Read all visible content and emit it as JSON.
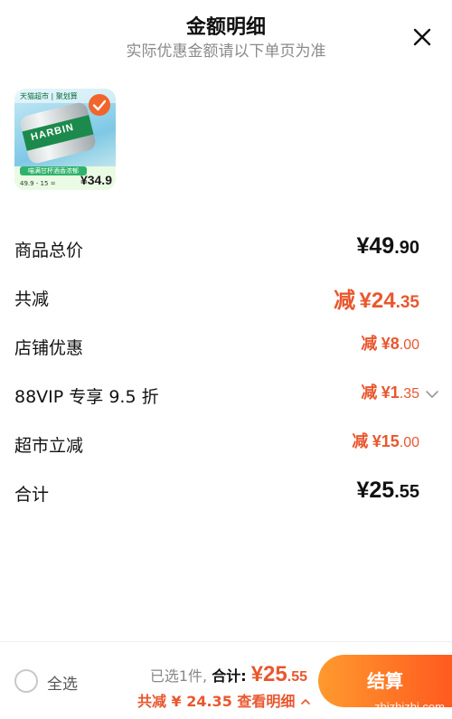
{
  "header": {
    "title": "金额明细",
    "subtitle": "实际优惠金额请以下单页为准"
  },
  "product": {
    "tag_text": "天猫超市 | 聚划算",
    "brand_text": "HARBIN",
    "green_bar_text": "喵满甘杯酒香浓郁",
    "nums_text": "49.9 - 15 =",
    "price_text": "¥34.9"
  },
  "rows": [
    {
      "label": "商品总价",
      "prefix": "",
      "main": "¥49",
      "decimal": ".90",
      "style": "black"
    },
    {
      "label": "共减",
      "prefix": "减",
      "main": "¥24",
      "decimal": ".35",
      "style": "orange-large"
    },
    {
      "label": "店铺优惠",
      "prefix": "减",
      "main": "¥8",
      "decimal": ".00",
      "style": "orange-small"
    },
    {
      "label": "88VIP 专享 9.5 折",
      "prefix": "减",
      "main": "¥1",
      "decimal": ".35",
      "style": "orange-small-chevron"
    },
    {
      "label": "超市立减",
      "prefix": "减",
      "main": "¥15",
      "decimal": ".00",
      "style": "orange-small"
    },
    {
      "label": "合计",
      "prefix": "",
      "main": "¥25",
      "decimal": ".55",
      "style": "black"
    }
  ],
  "bottom": {
    "select_all": "全选",
    "selected_text": "已选1件,",
    "total_label": "合计:",
    "total_main": "¥25",
    "total_decimal": ".55",
    "savings_text": "共减 ¥ 24.35",
    "detail_link": "查看明细",
    "checkout_label": "结算",
    "watermark": "zhizhizhi.com"
  },
  "colors": {
    "accent": "#e9572e",
    "checkout_gradient_start": "#ff9a2e",
    "checkout_gradient_end": "#ff5a1f"
  },
  "icons": {
    "close": "close-icon",
    "check": "check-icon",
    "chevron": "chevron-down-icon",
    "radio": "radio-unchecked-icon"
  }
}
